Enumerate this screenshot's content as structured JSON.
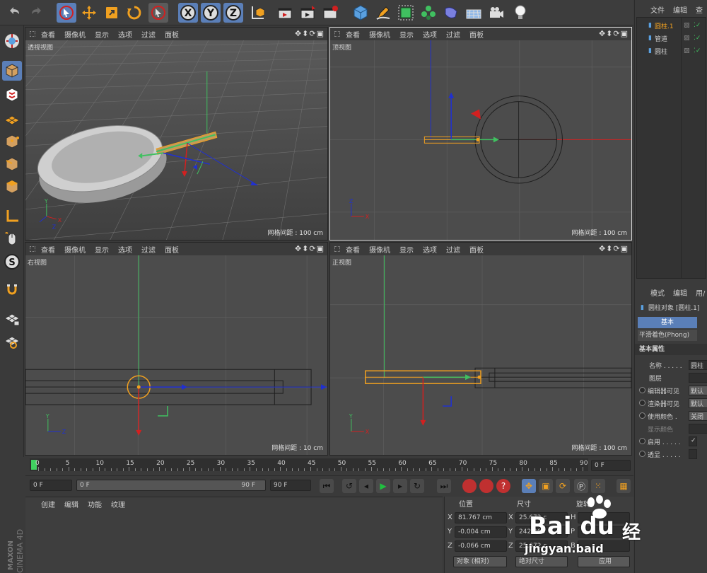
{
  "toolbar": {
    "icons": [
      "undo-icon",
      "redo-icon",
      "live-select-icon",
      "move-icon",
      "scale-icon",
      "rotate-icon",
      "select-icon",
      "x-axis-icon",
      "y-axis-icon",
      "z-axis-icon",
      "coordinate-system-icon",
      "render-view-icon",
      "render-picture-viewer-icon",
      "render-settings-icon",
      "cube-icon",
      "pen-icon",
      "subdivision-icon",
      "cloner-icon",
      "deformer-icon",
      "floor-icon",
      "camera-icon",
      "light-icon"
    ],
    "axis_x": "X",
    "axis_y": "Y",
    "axis_z": "Z"
  },
  "viewport_menu": [
    "查看",
    "摄像机",
    "显示",
    "选项",
    "过滤",
    "面板"
  ],
  "viewports": [
    {
      "name": "透视视图",
      "grid": "网格间距 : 100 cm"
    },
    {
      "name": "顶视图",
      "grid": "网格间距 : 100 cm"
    },
    {
      "name": "右视图",
      "grid": "网格间距 : 10 cm"
    },
    {
      "name": "正视图",
      "grid": "网格间距 : 100 cm"
    }
  ],
  "axis_labels": {
    "x": "X",
    "y": "Y",
    "z": "Z"
  },
  "timeline": {
    "ticks": [
      "0",
      "5",
      "10",
      "15",
      "20",
      "25",
      "30",
      "35",
      "40",
      "45",
      "50",
      "55",
      "60",
      "65",
      "70",
      "75",
      "80",
      "85",
      "90"
    ],
    "current": "0 F"
  },
  "controls": {
    "start": "0 F",
    "range_start": "0 F",
    "range_end": "90 F",
    "end": "90 F"
  },
  "material_menu": [
    "创建",
    "编辑",
    "功能",
    "纹理"
  ],
  "coords": {
    "headers": [
      "位置",
      "尺寸",
      "旋转"
    ],
    "rows": [
      {
        "axis": "X",
        "pos": "81.767 cm",
        "size_axis": "X",
        "size": "25.672 c",
        "rot_axis": "H"
      },
      {
        "axis": "Y",
        "pos": "-0.004 cm",
        "size_axis": "Y",
        "size": "242.268",
        "rot_axis": "P"
      },
      {
        "axis": "Z",
        "pos": "-0.066 cm",
        "size_axis": "Z",
        "size": "25.672 c",
        "rot_axis": "B"
      }
    ],
    "mode": "对象 (相对)",
    "size_mode": "绝对尺寸",
    "apply": "应用"
  },
  "object_manager": {
    "menu": [
      "文件",
      "编辑",
      "查"
    ],
    "items": [
      {
        "name": "圆柱.1",
        "selected": true
      },
      {
        "name": "管道",
        "selected": false
      },
      {
        "name": "圆柱",
        "selected": false
      }
    ]
  },
  "attributes": {
    "menu": [
      "模式",
      "编辑",
      "用/"
    ],
    "title": "圆柱对象 [圆柱.1]",
    "tab_basic": "基本",
    "tab_phong": "平滑着色(Phong)",
    "section": "基本属性",
    "rows": [
      {
        "label": "名称 . . . . .",
        "value": "圆柱"
      },
      {
        "label": "图层",
        "value": ""
      },
      {
        "label": "编辑器可见",
        "value": "默认"
      },
      {
        "label": "渲染器可见",
        "value": "默认"
      },
      {
        "label": "使用颜色 .",
        "value": "关闭"
      },
      {
        "label": "显示颜色",
        "value": ""
      },
      {
        "label": "启用 . . . . .",
        "value": "✓"
      },
      {
        "label": "透显 . . . . .",
        "value": ""
      }
    ]
  },
  "logo": {
    "brand": "MAXON",
    "product": "CINEMA 4D"
  },
  "watermark": {
    "site": "Bai du",
    "sub": "jingyan.baid",
    "tail": "经"
  },
  "colors": {
    "accent": "#f0a020",
    "x_axis": "#d22020",
    "y_axis": "#20b030",
    "z_axis": "#2030d0",
    "select": "#5a8fd8"
  }
}
